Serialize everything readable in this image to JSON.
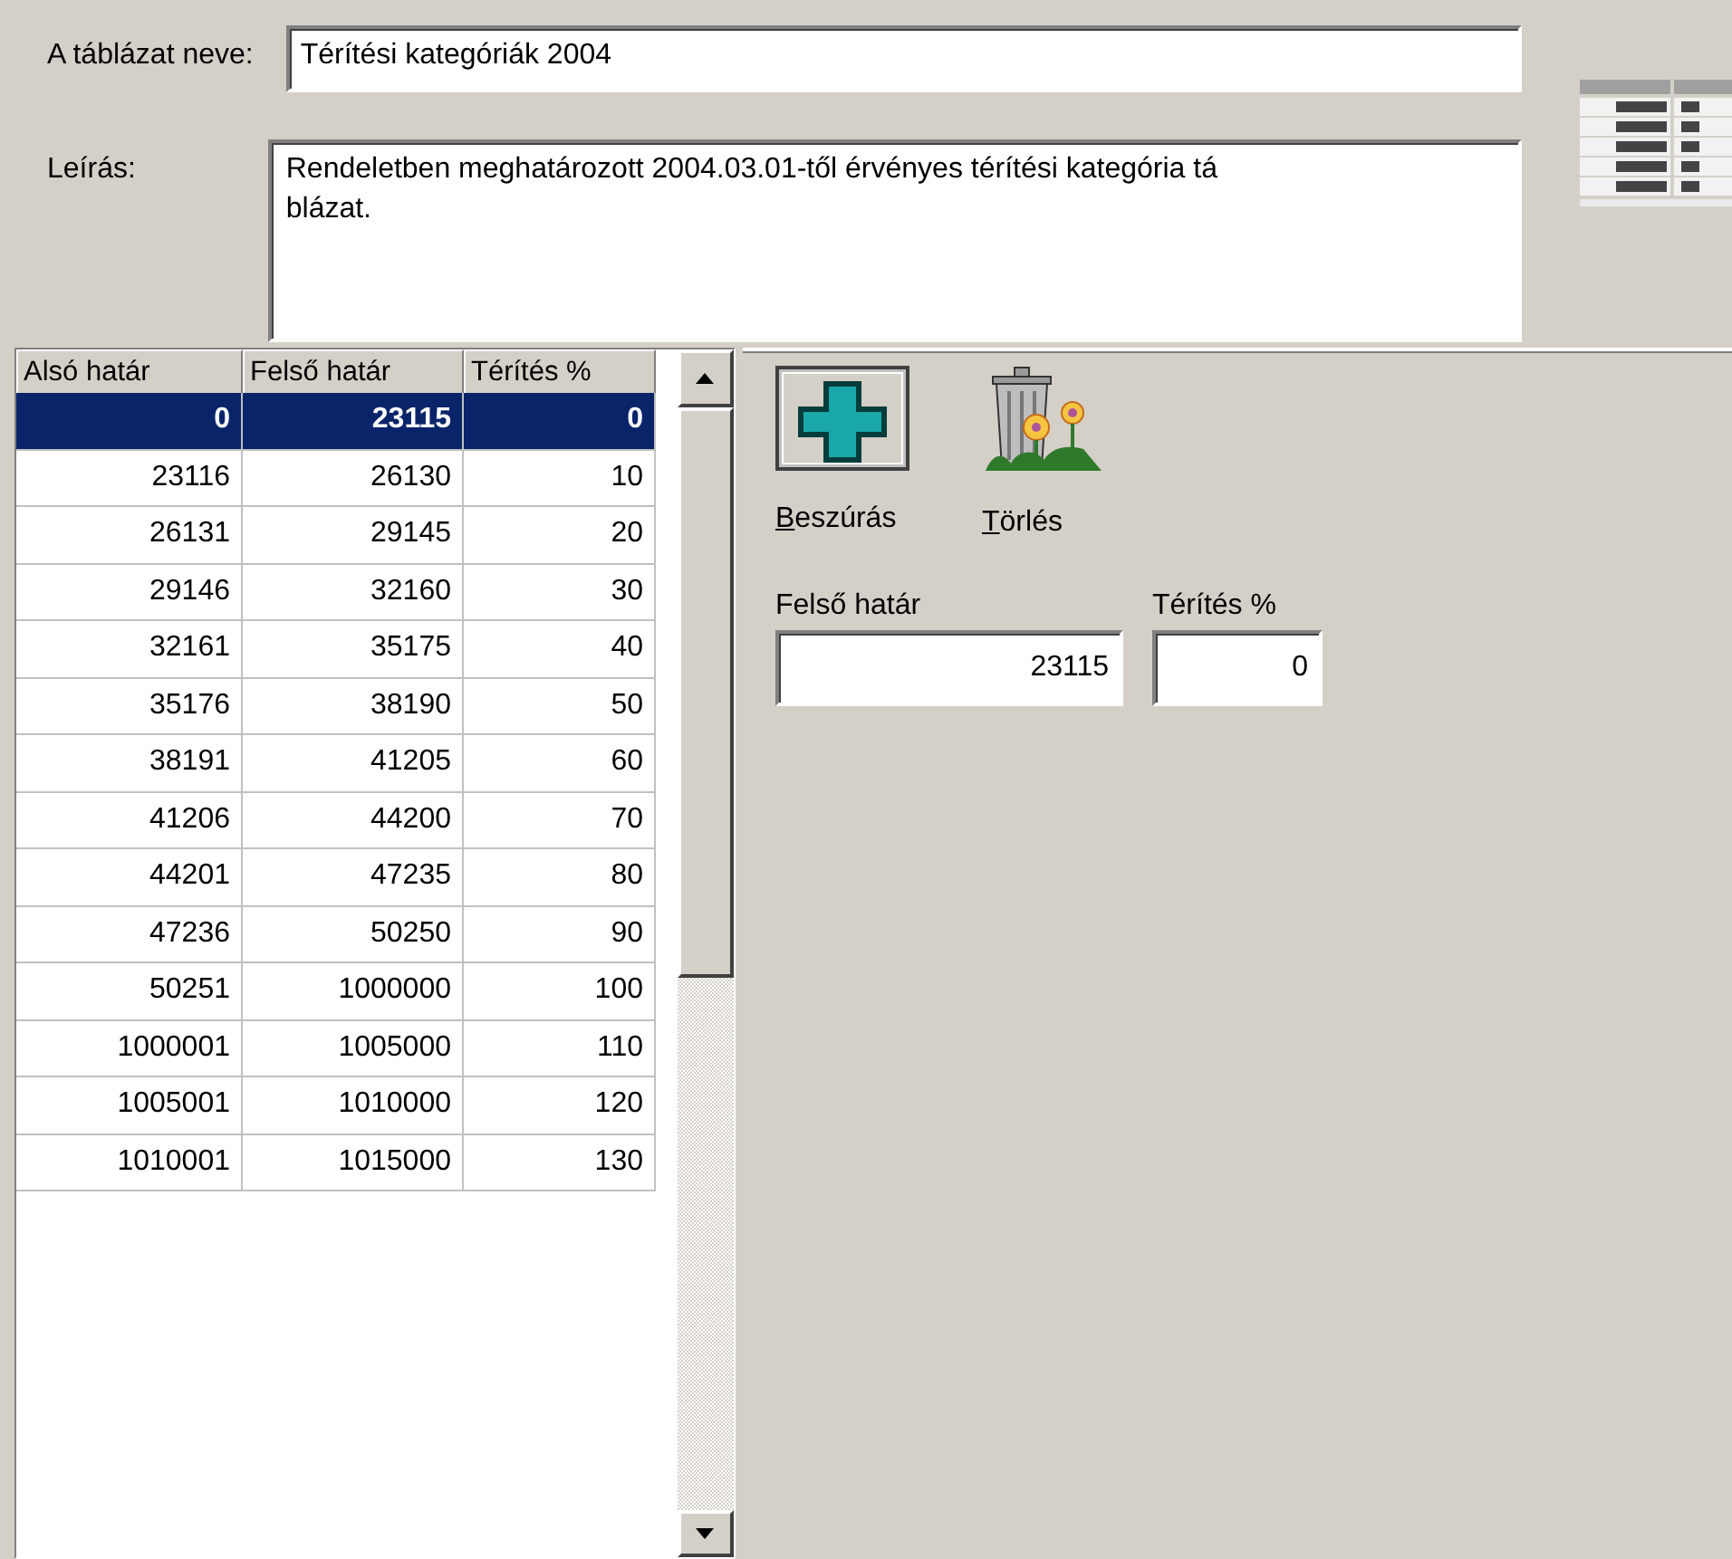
{
  "form": {
    "name_label": "A táblázat neve:",
    "name_value": "Térítési kategóriák 2004",
    "description_label": "Leírás:",
    "description_lines": [
      "Rendeletben meghatározott 2004.03.01-től érvényes térítési kategória tá",
      "blázat."
    ]
  },
  "table": {
    "columns": [
      "Alsó határ",
      "Felső határ",
      "Térítés %"
    ],
    "rows": [
      {
        "cells": [
          "0",
          "23115",
          "0"
        ],
        "selected": true
      },
      {
        "cells": [
          "23116",
          "26130",
          "10"
        ],
        "selected": false
      },
      {
        "cells": [
          "26131",
          "29145",
          "20"
        ],
        "selected": false
      },
      {
        "cells": [
          "29146",
          "32160",
          "30"
        ],
        "selected": false
      },
      {
        "cells": [
          "32161",
          "35175",
          "40"
        ],
        "selected": false
      },
      {
        "cells": [
          "35176",
          "38190",
          "50"
        ],
        "selected": false
      },
      {
        "cells": [
          "38191",
          "41205",
          "60"
        ],
        "selected": false
      },
      {
        "cells": [
          "41206",
          "44200",
          "70"
        ],
        "selected": false
      },
      {
        "cells": [
          "44201",
          "47235",
          "80"
        ],
        "selected": false
      },
      {
        "cells": [
          "47236",
          "50250",
          "90"
        ],
        "selected": false
      },
      {
        "cells": [
          "50251",
          "1000000",
          "100"
        ],
        "selected": false
      },
      {
        "cells": [
          "1000001",
          "1005000",
          "110"
        ],
        "selected": false
      },
      {
        "cells": [
          "1005001",
          "1010000",
          "120"
        ],
        "selected": false
      },
      {
        "cells": [
          "1010001",
          "1015000",
          "130"
        ],
        "selected": false
      }
    ]
  },
  "toolbar": [
    {
      "kind": "insert",
      "label": "Beszúrás",
      "first_letter_underlined": true
    },
    {
      "kind": "delete",
      "label": "Törlés",
      "first_letter_underlined": true
    }
  ],
  "editor": {
    "fields": [
      {
        "label": "Felső határ",
        "value": "23115"
      },
      {
        "label": "Térítés %",
        "value": "0"
      }
    ]
  }
}
